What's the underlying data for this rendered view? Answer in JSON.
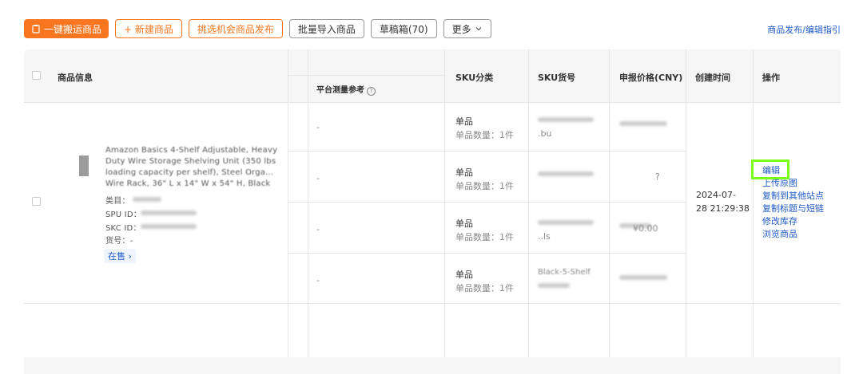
{
  "toolbar": {
    "one_click_move": "一键搬运商品",
    "new_product": "+ 新建商品",
    "pick_opportunity": "挑选机会商品发布",
    "bulk_import": "批量导入商品",
    "drafts": "草稿箱(70)",
    "more": "更多",
    "guide": "商品发布/编辑指引"
  },
  "table": {
    "headers": {
      "product_info": "商品信息",
      "platform_measure": "平台测量参考",
      "sku_category": "SKU分类",
      "sku_code": "SKU货号",
      "declared_price": "申报价格(CNY)",
      "created_time": "创建时间",
      "actions": "操作"
    },
    "rows": [
      {
        "measure": "-",
        "category": "单品",
        "qty_label": "单品数量：1件",
        "sku_code_fragment": ".bu"
      },
      {
        "measure": "-",
        "category": "单品",
        "qty_label": "单品数量：1件",
        "sku_code_fragment": "",
        "price_fragment": "?"
      },
      {
        "measure": "-",
        "category": "单品",
        "qty_label": "单品数量：1件",
        "sku_code_fragment": "..ls",
        "price_fragment": "¥0.00"
      },
      {
        "measure": "-",
        "category": "单品",
        "qty_label": "单品数量：1件",
        "sku_code_fragment": "Black-5-Shelf",
        "price_fragment": ""
      }
    ],
    "product": {
      "title_lines": [
        "Amazon Basics 4-Shelf Adjustable, Heavy",
        "Duty Wire Storage Shelving Unit (350 lbs",
        "loading capacity per shelf), Steel Orga...",
        "Wire Rack, 36\" L x 14\" W x 54\" H, Black"
      ],
      "category_label": "类目：",
      "spu_label": "SPU ID：",
      "skc_label": "SKC ID：",
      "item_code_label": "货号：-",
      "status": "在售 ›"
    },
    "created": {
      "date": "2024-07-",
      "time": "28 21:29:38"
    },
    "actions": [
      "编辑",
      "上传原图",
      "复制到其他站点",
      "复制标题与短链",
      "修改库存",
      "浏览商品"
    ]
  },
  "colors": {
    "accent": "#f7761f",
    "link": "#1f5ac9",
    "highlight": "#7bff1a"
  }
}
